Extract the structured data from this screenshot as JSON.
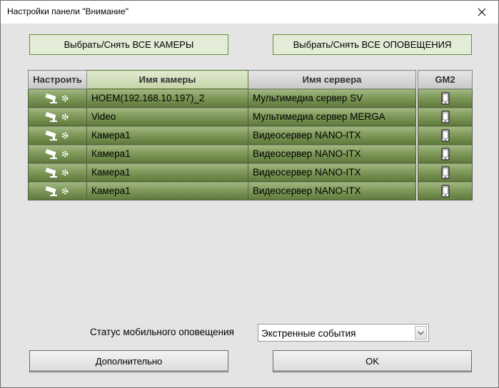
{
  "window": {
    "title": "Настройки панели \"Внимание\""
  },
  "top_buttons": {
    "select_cameras": "Выбрать/Снять ВСЕ КАМЕРЫ",
    "select_alerts": "Выбрать/Снять ВСЕ ОПОВЕЩЕНИЯ"
  },
  "table": {
    "headers": {
      "configure": "Настроить",
      "camera_name": "Имя камеры",
      "server_name": "Имя сервера",
      "gm2": "GM2"
    },
    "rows": [
      {
        "camera": "HOEM(192.168.10.197)_2",
        "server": "Мультимедиа сервер SV",
        "configure_icon": "camera-settings-icon",
        "gm2_icon": "phone-icon"
      },
      {
        "camera": "Video",
        "server": "Мультимедиа сервер MERGA",
        "configure_icon": "camera-settings-icon",
        "gm2_icon": "phone-icon"
      },
      {
        "camera": "Камера1",
        "server": "Видеосервер NANO-ITX",
        "configure_icon": "camera-settings-icon",
        "gm2_icon": "phone-icon"
      },
      {
        "camera": "Камера1",
        "server": "Видеосервер NANO-ITX",
        "configure_icon": "camera-settings-icon",
        "gm2_icon": "phone-icon"
      },
      {
        "camera": "Камера1",
        "server": "Видеосервер NANO-ITX",
        "configure_icon": "camera-settings-icon",
        "gm2_icon": "phone-icon"
      },
      {
        "camera": "Камера1",
        "server": "Видеосервер NANO-ITX",
        "configure_icon": "camera-settings-icon",
        "gm2_icon": "phone-icon"
      }
    ]
  },
  "status": {
    "label": "Статус мобильного оповещения",
    "selected": "Экстренные события"
  },
  "bottom_buttons": {
    "advanced": "Дополнительно",
    "ok": "OK"
  },
  "colors": {
    "row_green": "#7f9a5a",
    "button_green_border": "#6a8b3e",
    "window_bg": "#e4e4e4"
  }
}
